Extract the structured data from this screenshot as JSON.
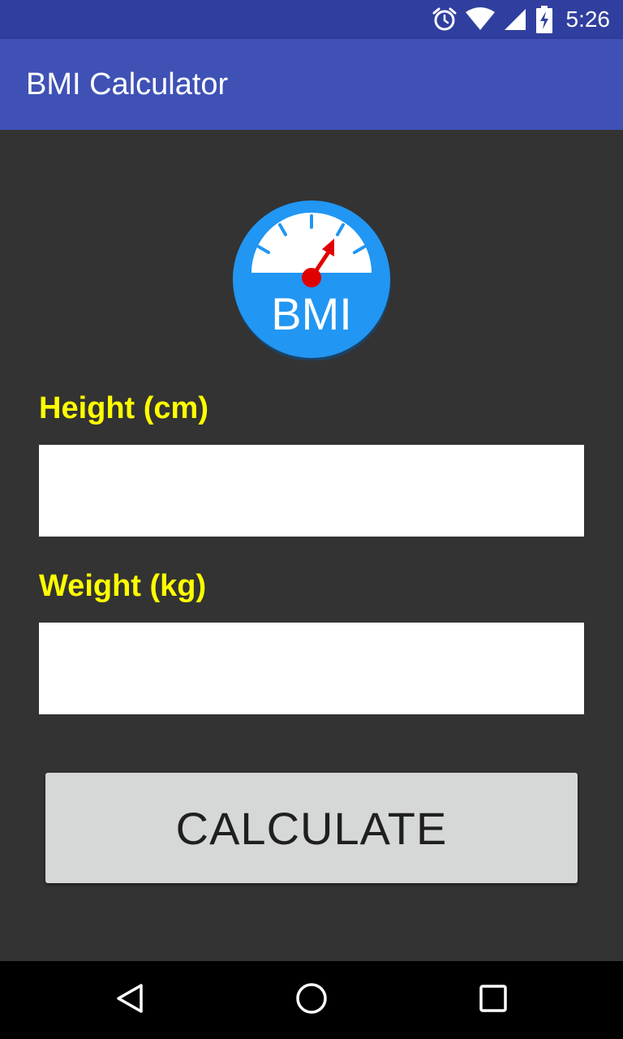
{
  "status_bar": {
    "time": "5:26",
    "icons": [
      "alarm-icon",
      "wifi-icon",
      "signal-icon",
      "battery-charging-icon"
    ]
  },
  "app_bar": {
    "title": "BMI Calculator"
  },
  "logo": {
    "text": "BMI",
    "icon": "bmi-gauge-icon",
    "colors": {
      "circle": "#2196f3",
      "gauge": "#ffffff",
      "needle": "#e00000"
    }
  },
  "form": {
    "height_label": "Height (cm)",
    "height_value": "",
    "weight_label": "Weight (kg)",
    "weight_value": "",
    "label_color": "#ffff00"
  },
  "calculate_button": {
    "label": "CALCULATE"
  },
  "nav_bar": {
    "icons": [
      "back-icon",
      "home-icon",
      "recent-apps-icon"
    ]
  },
  "colors": {
    "status_bar": "#303f9f",
    "app_bar": "#3f51b5",
    "background": "#333333",
    "button": "#d6d7d7"
  }
}
